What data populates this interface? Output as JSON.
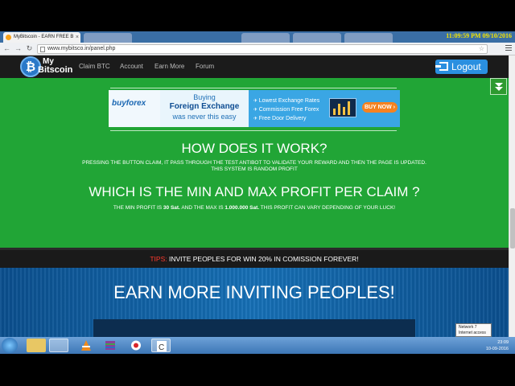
{
  "browser": {
    "tab_title": "MyBitscoin - EARN FREE B",
    "tab_close": "×",
    "clock": "11:09:59 PM 09/10/2016",
    "url": "www.mybitsco.in/panel.php"
  },
  "site": {
    "logo_line1": "My",
    "logo_line2": "Bitscoin",
    "logo_mark": "₿",
    "nav": [
      "Claim BTC",
      "Account",
      "Earn More",
      "Forum"
    ],
    "logout_label": "Logout"
  },
  "ad": {
    "brand": "buyforex",
    "line1": "Buying",
    "line2": "Foreign Exchange",
    "line3": "was never this easy",
    "features": [
      "Lowest Exchange Rates",
      "Commission Free Forex",
      "Free Door Delivery"
    ],
    "cta": "BUY NOW ›"
  },
  "how": {
    "heading": "HOW DOES IT WORK?",
    "text1": "PRESSING THE BUTTON CLAIM, IT PASS THROUGH THE TEST ANTIBOT TO VALIDATE YOUR REWARD AND THEN THE PAGE IS UPDATED.",
    "text2": "THIS SYSTEM IS RANDOM PROFIT"
  },
  "profit": {
    "heading": "WHICH IS THE MIN AND MAX PROFIT PER CLAIM ?",
    "pre": "THE MIN PROFIT IS ",
    "min": "30 Sat.",
    "mid": " AND THE MAX IS ",
    "max": "1.000.000 Sat.",
    "post": " THIS PROFIT CAN VARY DEPENDING OF YOUR LUCK!"
  },
  "tips": {
    "label": "TIPS:",
    "text": " INVITE PEOPLES FOR WIN 20% IN COMISSION FOREVER!"
  },
  "invite": {
    "heading": "EARN MORE INVITING PEOPLES!"
  },
  "taskbar": {
    "tooltip_line1": "Network  7",
    "tooltip_line2": "Internet access",
    "time": "23:09",
    "date": "10-09-2016"
  },
  "colors": {
    "green_section": "#21a536",
    "blue_section": "#1670b6",
    "logout_button": "#2a8fe0",
    "tips_label": "#ff3a2e"
  }
}
